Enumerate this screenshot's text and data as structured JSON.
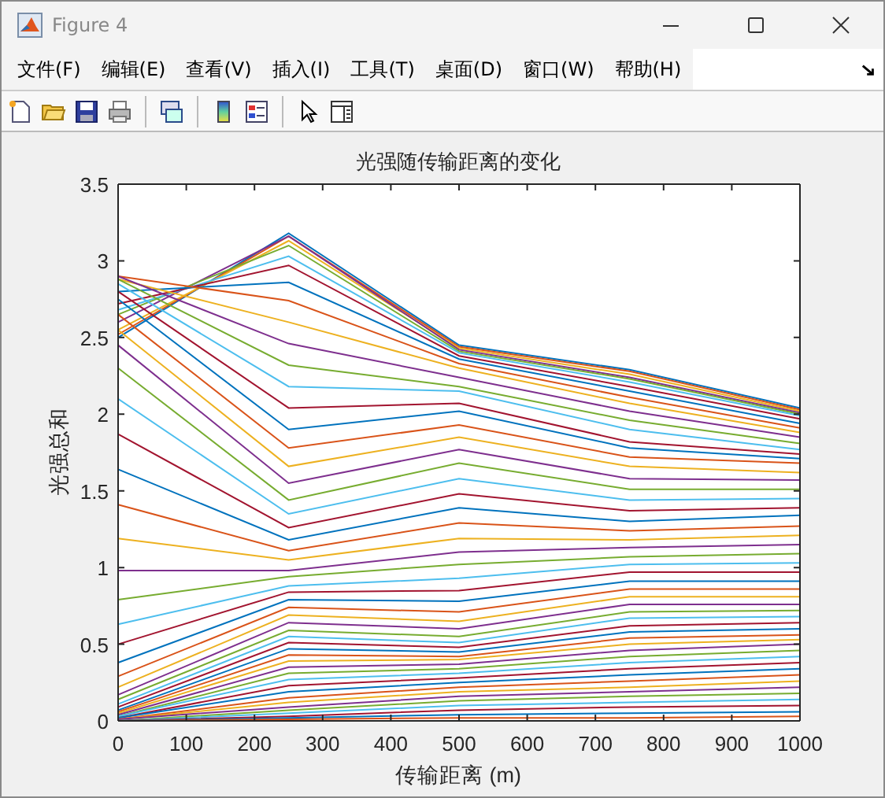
{
  "window": {
    "title": "Figure 4"
  },
  "menu": [
    {
      "label": "文件(F)"
    },
    {
      "label": "编辑(E)"
    },
    {
      "label": "查看(V)"
    },
    {
      "label": "插入(I)"
    },
    {
      "label": "工具(T)"
    },
    {
      "label": "桌面(D)"
    },
    {
      "label": "窗口(W)"
    },
    {
      "label": "帮助(H)"
    }
  ],
  "figure": {
    "chart_data": {
      "type": "line",
      "title": "光强随传输距离的变化",
      "xlabel": "传输距离 (m)",
      "ylabel": "光强总和",
      "x": [
        0,
        250,
        500,
        750,
        1000
      ],
      "xlim": [
        0,
        1000
      ],
      "ylim": [
        0,
        3.5
      ],
      "xticks": [
        0,
        100,
        200,
        300,
        400,
        500,
        600,
        700,
        800,
        900,
        1000
      ],
      "yticks": [
        0,
        0.5,
        1,
        1.5,
        2,
        2.5,
        3,
        3.5
      ],
      "series": [
        {
          "color": "#0072bd",
          "values": [
            2.5,
            3.18,
            2.45,
            2.29,
            2.04
          ]
        },
        {
          "color": "#d95319",
          "values": [
            2.52,
            3.16,
            2.44,
            2.28,
            2.03
          ]
        },
        {
          "color": "#edb120",
          "values": [
            2.55,
            3.13,
            2.43,
            2.26,
            2.02
          ]
        },
        {
          "color": "#7e2f8e",
          "values": [
            2.6,
            3.16,
            2.42,
            2.24,
            2.01
          ]
        },
        {
          "color": "#77ac30",
          "values": [
            2.65,
            3.1,
            2.41,
            2.23,
            2.0
          ]
        },
        {
          "color": "#4dbeee",
          "values": [
            2.68,
            3.03,
            2.4,
            2.21,
            1.99
          ]
        },
        {
          "color": "#a2142f",
          "values": [
            2.72,
            2.97,
            2.38,
            2.18,
            1.97
          ]
        },
        {
          "color": "#0072bd",
          "values": [
            2.8,
            2.86,
            2.36,
            2.15,
            1.94
          ]
        },
        {
          "color": "#d95319",
          "values": [
            2.9,
            2.74,
            2.33,
            2.11,
            1.91
          ]
        },
        {
          "color": "#edb120",
          "values": [
            2.88,
            2.6,
            2.3,
            2.07,
            1.88
          ]
        },
        {
          "color": "#7e2f8e",
          "values": [
            2.9,
            2.46,
            2.24,
            2.02,
            1.85
          ]
        },
        {
          "color": "#77ac30",
          "values": [
            2.88,
            2.32,
            2.18,
            1.96,
            1.81
          ]
        },
        {
          "color": "#4dbeee",
          "values": [
            2.85,
            2.18,
            2.15,
            1.9,
            1.77
          ]
        },
        {
          "color": "#a2142f",
          "values": [
            2.8,
            2.04,
            2.07,
            1.82,
            1.74
          ]
        },
        {
          "color": "#0072bd",
          "values": [
            2.75,
            1.9,
            2.02,
            1.78,
            1.71
          ]
        },
        {
          "color": "#d95319",
          "values": [
            2.65,
            1.78,
            1.93,
            1.72,
            1.68
          ]
        },
        {
          "color": "#edb120",
          "values": [
            2.55,
            1.66,
            1.85,
            1.66,
            1.62
          ]
        },
        {
          "color": "#7e2f8e",
          "values": [
            2.45,
            1.55,
            1.77,
            1.58,
            1.57
          ]
        },
        {
          "color": "#77ac30",
          "values": [
            2.3,
            1.44,
            1.68,
            1.51,
            1.51
          ]
        },
        {
          "color": "#4dbeee",
          "values": [
            2.1,
            1.35,
            1.58,
            1.44,
            1.45
          ]
        },
        {
          "color": "#a2142f",
          "values": [
            1.87,
            1.26,
            1.48,
            1.37,
            1.39
          ]
        },
        {
          "color": "#0072bd",
          "values": [
            1.64,
            1.18,
            1.39,
            1.3,
            1.34
          ]
        },
        {
          "color": "#d95319",
          "values": [
            1.41,
            1.11,
            1.29,
            1.24,
            1.27
          ]
        },
        {
          "color": "#edb120",
          "values": [
            1.19,
            1.05,
            1.19,
            1.18,
            1.21
          ]
        },
        {
          "color": "#7e2f8e",
          "values": [
            0.98,
            0.98,
            1.1,
            1.13,
            1.15
          ]
        },
        {
          "color": "#77ac30",
          "values": [
            0.79,
            0.94,
            1.02,
            1.07,
            1.09
          ]
        },
        {
          "color": "#4dbeee",
          "values": [
            0.63,
            0.88,
            0.93,
            1.02,
            1.03
          ]
        },
        {
          "color": "#a2142f",
          "values": [
            0.5,
            0.84,
            0.85,
            0.97,
            0.97
          ]
        },
        {
          "color": "#0072bd",
          "values": [
            0.38,
            0.79,
            0.78,
            0.91,
            0.91
          ]
        },
        {
          "color": "#d95319",
          "values": [
            0.29,
            0.74,
            0.71,
            0.86,
            0.86
          ]
        },
        {
          "color": "#edb120",
          "values": [
            0.22,
            0.69,
            0.65,
            0.81,
            0.81
          ]
        },
        {
          "color": "#7e2f8e",
          "values": [
            0.17,
            0.64,
            0.6,
            0.76,
            0.76
          ]
        },
        {
          "color": "#77ac30",
          "values": [
            0.14,
            0.59,
            0.55,
            0.71,
            0.72
          ]
        },
        {
          "color": "#4dbeee",
          "values": [
            0.11,
            0.55,
            0.51,
            0.67,
            0.68
          ]
        },
        {
          "color": "#a2142f",
          "values": [
            0.09,
            0.51,
            0.48,
            0.62,
            0.64
          ]
        },
        {
          "color": "#0072bd",
          "values": [
            0.07,
            0.47,
            0.45,
            0.58,
            0.6
          ]
        },
        {
          "color": "#d95319",
          "values": [
            0.06,
            0.43,
            0.42,
            0.54,
            0.56
          ]
        },
        {
          "color": "#edb120",
          "values": [
            0.05,
            0.39,
            0.4,
            0.5,
            0.53
          ]
        },
        {
          "color": "#7e2f8e",
          "values": [
            0.04,
            0.35,
            0.37,
            0.46,
            0.5
          ]
        },
        {
          "color": "#77ac30",
          "values": [
            0.03,
            0.31,
            0.34,
            0.42,
            0.46
          ]
        },
        {
          "color": "#4dbeee",
          "values": [
            0.03,
            0.27,
            0.31,
            0.38,
            0.42
          ]
        },
        {
          "color": "#a2142f",
          "values": [
            0.02,
            0.23,
            0.28,
            0.34,
            0.38
          ]
        },
        {
          "color": "#0072bd",
          "values": [
            0.02,
            0.19,
            0.25,
            0.3,
            0.34
          ]
        },
        {
          "color": "#d95319",
          "values": [
            0.01,
            0.15,
            0.22,
            0.26,
            0.3
          ]
        },
        {
          "color": "#edb120",
          "values": [
            0.01,
            0.12,
            0.19,
            0.22,
            0.26
          ]
        },
        {
          "color": "#7e2f8e",
          "values": [
            0.01,
            0.09,
            0.16,
            0.19,
            0.22
          ]
        },
        {
          "color": "#77ac30",
          "values": [
            0,
            0.07,
            0.13,
            0.16,
            0.18
          ]
        },
        {
          "color": "#4dbeee",
          "values": [
            0,
            0.05,
            0.1,
            0.12,
            0.14
          ]
        },
        {
          "color": "#a2142f",
          "values": [
            0,
            0.03,
            0.07,
            0.09,
            0.1
          ]
        },
        {
          "color": "#0072bd",
          "values": [
            0,
            0.02,
            0.04,
            0.05,
            0.06
          ]
        },
        {
          "color": "#d95319",
          "values": [
            0,
            0.01,
            0.02,
            0.02,
            0.03
          ]
        }
      ]
    }
  }
}
